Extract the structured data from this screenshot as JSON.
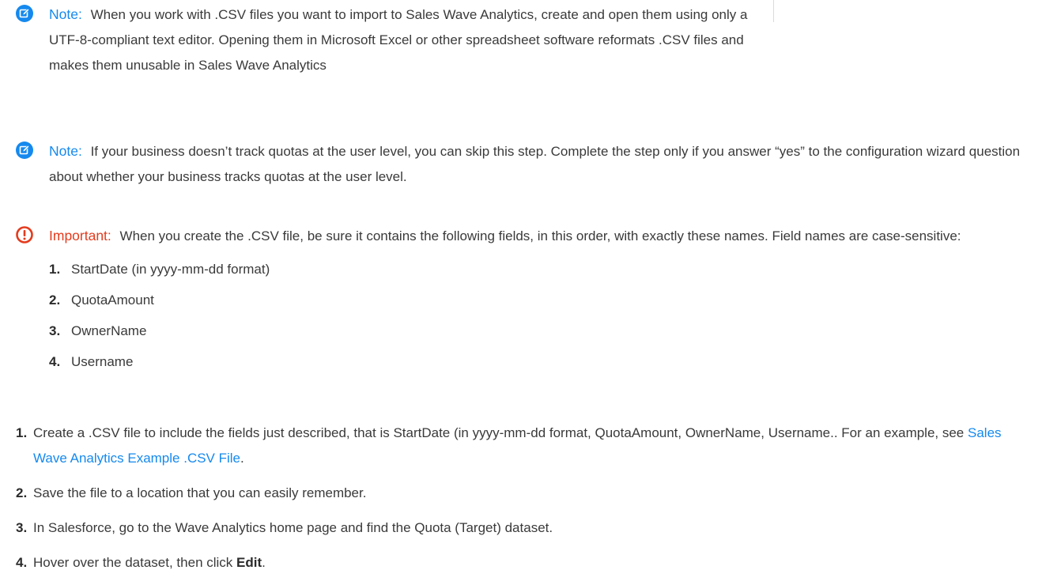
{
  "colors": {
    "note_accent": "#1589ee",
    "important_accent": "#e43b1d",
    "text": "#3a3a3a",
    "link": "#1589ee"
  },
  "note1": {
    "icon": "edit-note-icon",
    "label": "Note:",
    "text": "When you work with .CSV files you want to import to Sales Wave Analytics, create and open them using only a UTF-8-compliant text editor. Opening them in Microsoft Excel or other spreadsheet software reformats .CSV files and makes them unusable in Sales Wave Analytics"
  },
  "note2": {
    "icon": "edit-note-icon",
    "label": "Note:",
    "text": "If your business doesn’t track quotas at the user level, you can skip this step. Complete the step only if you answer “yes” to the configuration wizard question about whether your business tracks quotas at the user level."
  },
  "important": {
    "icon": "exclamation-circle-icon",
    "label": "Important:",
    "text": "When you create the .CSV file, be sure it contains the following fields, in this order, with exactly these names. Field names are case-sensitive:",
    "fields": [
      {
        "num": "1.",
        "text": "StartDate (in yyyy-mm-dd format)"
      },
      {
        "num": "2.",
        "text": "QuotaAmount"
      },
      {
        "num": "3.",
        "text": "OwnerName"
      },
      {
        "num": "4.",
        "text": "Username"
      }
    ]
  },
  "steps": [
    {
      "num": "1.",
      "text": "Create a .CSV file to include the fields just described, that is StartDate (in yyyy-mm-dd format, QuotaAmount, OwnerName, Username.. For an example, see ",
      "link": "Sales Wave Analytics Example .CSV File",
      "after": "."
    },
    {
      "num": "2.",
      "text": "Save the file to a location that you can easily remember."
    },
    {
      "num": "3.",
      "text": "In Salesforce, go to the Wave Analytics home page and find the Quota (Target) dataset."
    },
    {
      "num": "4.",
      "text": "Hover over the dataset, then click ",
      "bold": "Edit",
      "after": "."
    }
  ]
}
